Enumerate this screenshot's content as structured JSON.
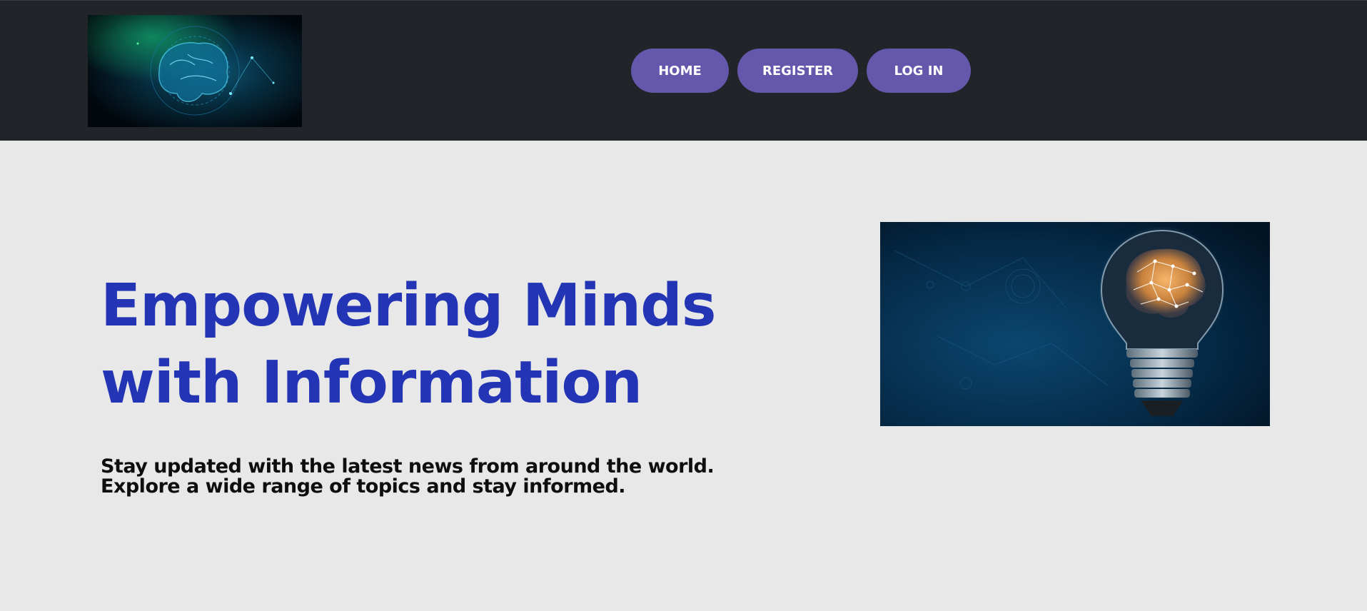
{
  "header": {
    "logo_icon": "brain-circuit-logo",
    "nav": [
      {
        "label": "HOME"
      },
      {
        "label": "REGISTER"
      },
      {
        "label": "LOG IN"
      }
    ],
    "nav_color": "#6557ab",
    "background_color": "#212429"
  },
  "hero": {
    "title_line1": "Empowering Minds",
    "title_line2": "with Information",
    "subtitle_line1": "Stay updated with the latest news from around the world.",
    "subtitle_line2": "Explore a wide range of topics and stay informed.",
    "title_color": "#2335b5",
    "image_icon": "lightbulb-brain-image"
  }
}
